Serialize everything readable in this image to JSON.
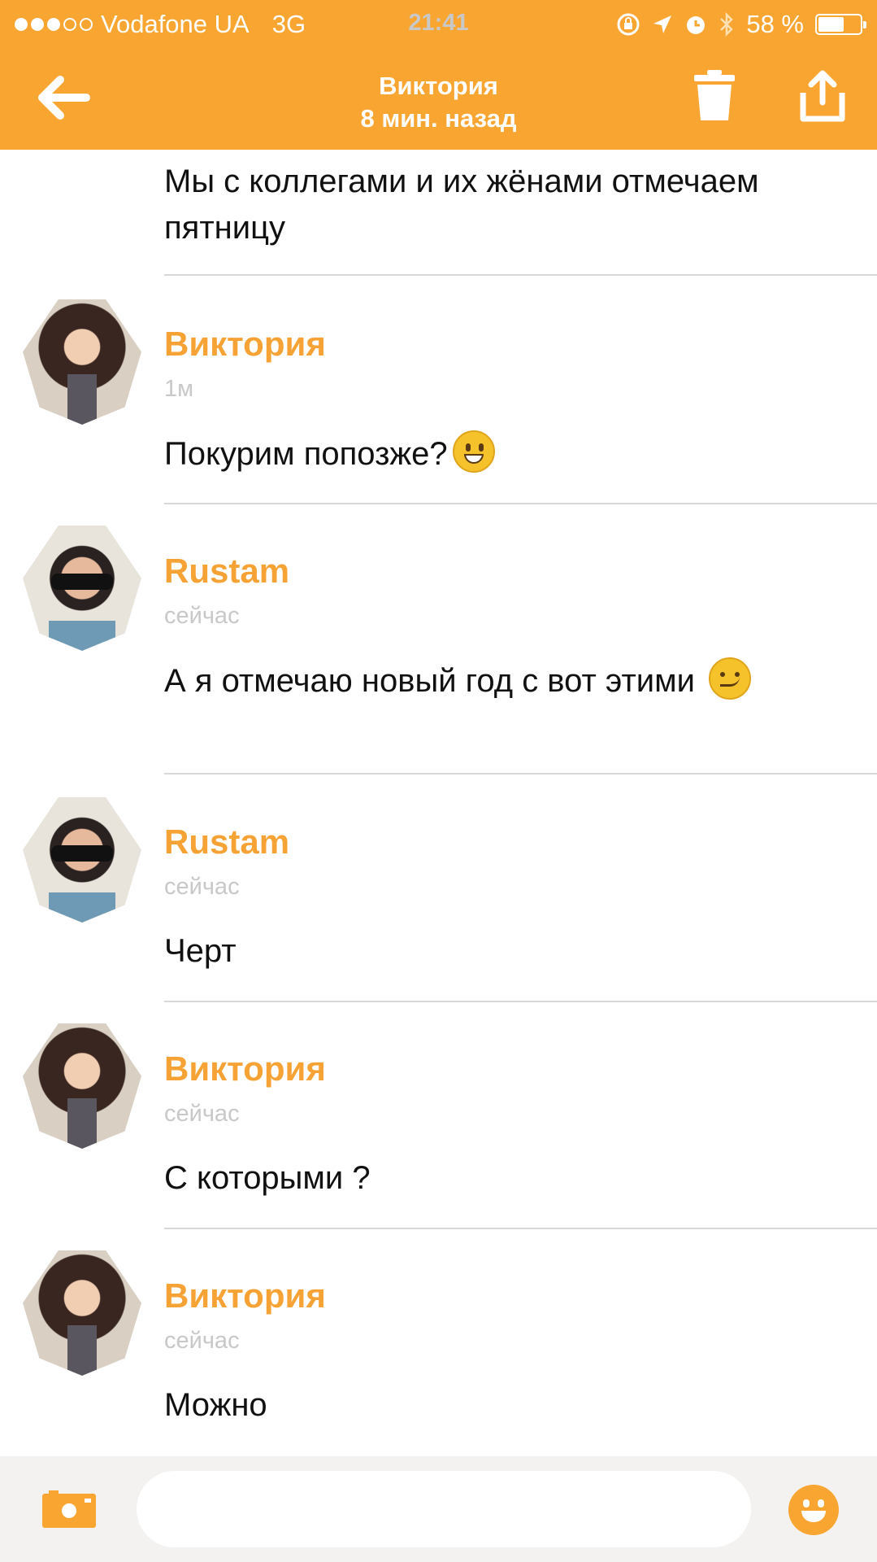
{
  "status_bar": {
    "carrier": "Vodafone UA",
    "network": "3G",
    "time": "21:41",
    "battery": "58 %"
  },
  "header": {
    "title": "Виктория",
    "subtitle": "8 мин. назад"
  },
  "messages": [
    {
      "author": "",
      "time": "",
      "text": "Мы с коллегами и их жёнами отмечаем пятницу"
    },
    {
      "author": "Виктория",
      "time": "1м",
      "text": "Покурим попозже?"
    },
    {
      "author": "Rustam",
      "time": "сейчас",
      "text": "А я отмечаю новый год с вот этими"
    },
    {
      "author": "Rustam",
      "time": "сейчас",
      "text": "Черт"
    },
    {
      "author": "Виктория",
      "time": "сейчас",
      "text": "С которыми ?"
    },
    {
      "author": "Виктория",
      "time": "сейчас",
      "text": "Можно"
    }
  ],
  "input": {
    "placeholder": ""
  },
  "colors": {
    "accent": "#f9a531",
    "author": "#f7a235",
    "timestamp": "#c8c8c8"
  }
}
